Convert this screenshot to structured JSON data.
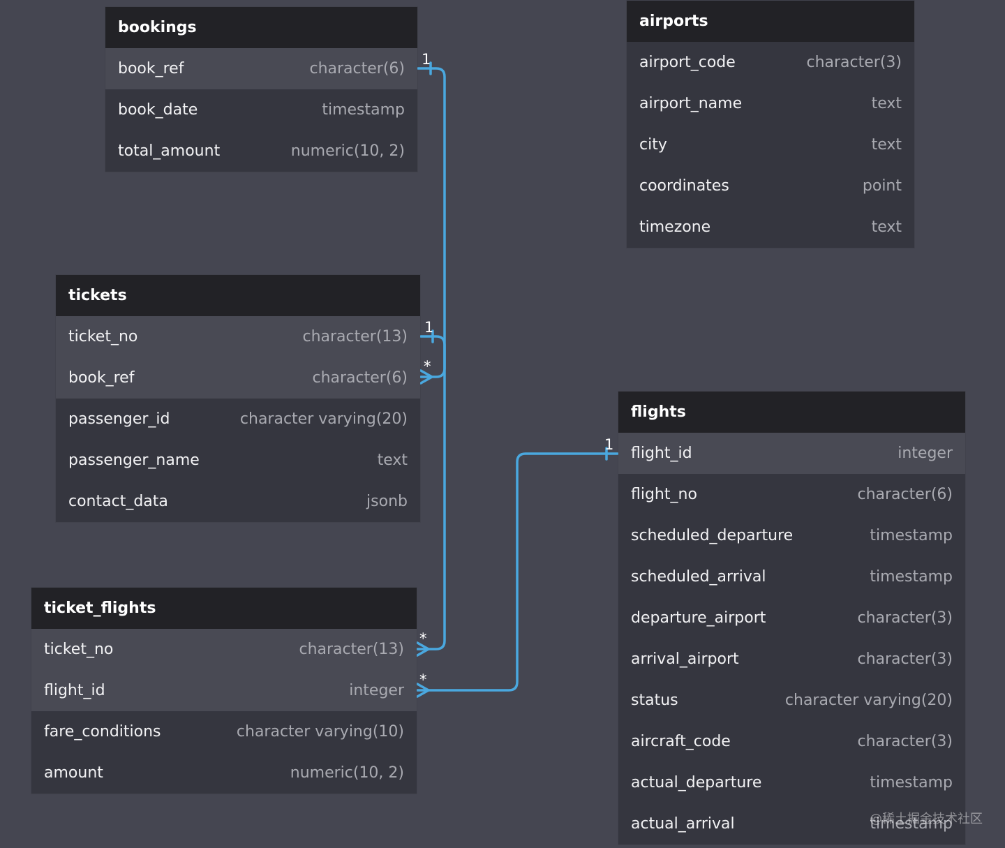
{
  "tables": {
    "bookings": {
      "title": "bookings",
      "rows": [
        {
          "name": "book_ref",
          "type": "character(6)",
          "key": true
        },
        {
          "name": "book_date",
          "type": "timestamp",
          "key": false
        },
        {
          "name": "total_amount",
          "type": "numeric(10, 2)",
          "key": false
        }
      ]
    },
    "airports": {
      "title": "airports",
      "rows": [
        {
          "name": "airport_code",
          "type": "character(3)",
          "key": false
        },
        {
          "name": "airport_name",
          "type": "text",
          "key": false
        },
        {
          "name": "city",
          "type": "text",
          "key": false
        },
        {
          "name": "coordinates",
          "type": "point",
          "key": false
        },
        {
          "name": "timezone",
          "type": "text",
          "key": false
        }
      ]
    },
    "tickets": {
      "title": "tickets",
      "rows": [
        {
          "name": "ticket_no",
          "type": "character(13)",
          "key": true
        },
        {
          "name": "book_ref",
          "type": "character(6)",
          "key": true
        },
        {
          "name": "passenger_id",
          "type": "character varying(20)",
          "key": false
        },
        {
          "name": "passenger_name",
          "type": "text",
          "key": false
        },
        {
          "name": "contact_data",
          "type": "jsonb",
          "key": false
        }
      ]
    },
    "ticket_flights": {
      "title": "ticket_flights",
      "rows": [
        {
          "name": "ticket_no",
          "type": "character(13)",
          "key": true
        },
        {
          "name": "flight_id",
          "type": "integer",
          "key": true
        },
        {
          "name": "fare_conditions",
          "type": "character varying(10)",
          "key": false
        },
        {
          "name": "amount",
          "type": "numeric(10, 2)",
          "key": false
        }
      ]
    },
    "flights": {
      "title": "flights",
      "rows": [
        {
          "name": "flight_id",
          "type": "integer",
          "key": true
        },
        {
          "name": "flight_no",
          "type": "character(6)",
          "key": false
        },
        {
          "name": "scheduled_departure",
          "type": "timestamp",
          "key": false
        },
        {
          "name": "scheduled_arrival",
          "type": "timestamp",
          "key": false
        },
        {
          "name": "departure_airport",
          "type": "character(3)",
          "key": false
        },
        {
          "name": "arrival_airport",
          "type": "character(3)",
          "key": false
        },
        {
          "name": "status",
          "type": "character varying(20)",
          "key": false
        },
        {
          "name": "aircraft_code",
          "type": "character(3)",
          "key": false
        },
        {
          "name": "actual_departure",
          "type": "timestamp",
          "key": false
        },
        {
          "name": "actual_arrival",
          "type": "timestamp",
          "key": false
        }
      ]
    }
  },
  "relations": [
    {
      "from": "bookings.book_ref",
      "to": "tickets.book_ref",
      "from_card": "1",
      "to_card": "*"
    },
    {
      "from": "tickets.ticket_no",
      "to": "ticket_flights.ticket_no",
      "from_card": "1",
      "to_card": "*"
    },
    {
      "from": "flights.flight_id",
      "to": "ticket_flights.flight_id",
      "from_card": "1",
      "to_card": "*"
    }
  ],
  "colors": {
    "background": "#454651",
    "header": "#222226",
    "body": "#35363f",
    "key_row": "#494a54",
    "link": "#4aa8df"
  },
  "watermark": "@稀土掘金技术社区"
}
